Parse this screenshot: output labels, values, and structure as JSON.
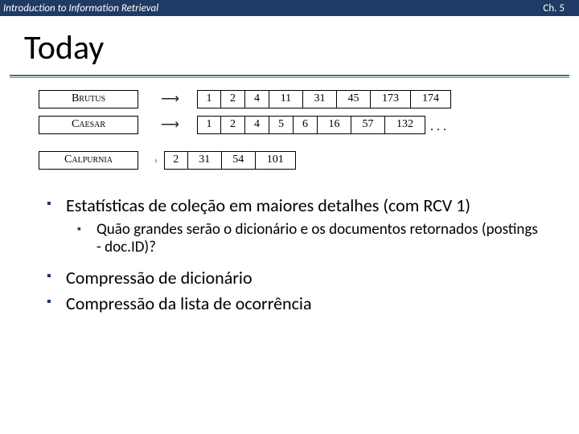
{
  "header": {
    "course": "Introduction to Information Retrieval",
    "chapter": "Ch. 5"
  },
  "title": "Today",
  "postings": {
    "rows": [
      {
        "term": "Brutus",
        "list": [
          "1",
          "2",
          "4",
          "11",
          "31",
          "45",
          "173",
          "174"
        ],
        "widths": [
          30,
          30,
          30,
          42,
          42,
          42,
          50,
          50
        ]
      },
      {
        "term": "Caesar",
        "list": [
          "1",
          "2",
          "4",
          "5",
          "6",
          "16",
          "57",
          "132"
        ],
        "widths": [
          30,
          30,
          30,
          30,
          30,
          42,
          42,
          50
        ],
        "dots": ". . ."
      },
      {
        "term": "Calpurnia",
        "list": [
          "2",
          "31",
          "54",
          "101"
        ],
        "widths": [
          30,
          42,
          42,
          50
        ]
      }
    ]
  },
  "bullets": {
    "b1a": "Estatísticas de coleção em maiores detalhes (com RCV 1)",
    "b2a": "Quão grandes serão o dicionário e os documentos retornados (postings - doc.ID)?",
    "b1b": "Compressão de dicionário",
    "b1c": "Compressão da lista de ocorrência"
  }
}
